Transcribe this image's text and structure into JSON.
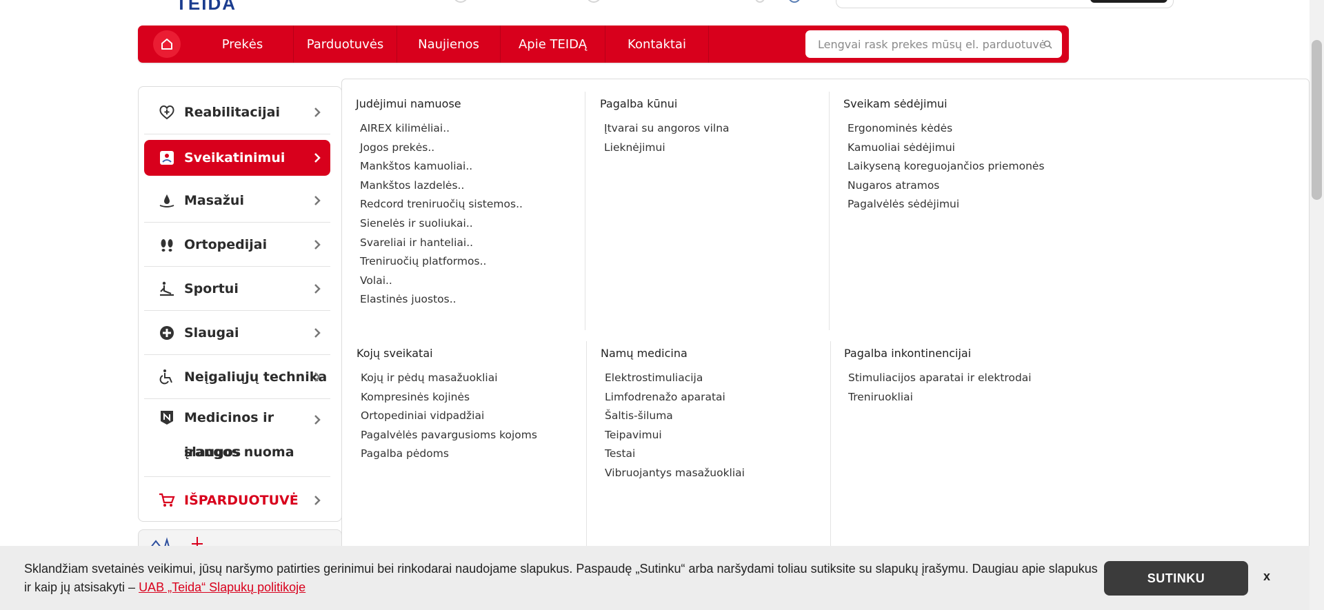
{
  "logo_text": "TEIDA",
  "nav": {
    "items": [
      {
        "label": "Prekės"
      },
      {
        "label": "Parduotuvės"
      },
      {
        "label": "Naujienos"
      },
      {
        "label": "Apie TEIDĄ"
      },
      {
        "label": "Kontaktai"
      }
    ],
    "search_placeholder": "Lengvai rask prekes mūsų el. parduotuvėje"
  },
  "sidebar": {
    "items": [
      {
        "label": "Reabilitacijai",
        "icon": "heart-plus-icon",
        "active": false
      },
      {
        "label": "Sveikatinimui",
        "icon": "wellness-icon",
        "active": true
      },
      {
        "label": "Masažui",
        "icon": "drop-icon",
        "active": false
      },
      {
        "label": "Ortopedijai",
        "icon": "footprints-icon",
        "active": false
      },
      {
        "label": "Sportui",
        "icon": "exercise-icon",
        "active": false
      },
      {
        "label": "Slaugai",
        "icon": "plus-circle-icon",
        "active": false
      },
      {
        "label": "Neįgaliųjų technika",
        "icon": "wheelchair-icon",
        "active": false
      },
      {
        "label": "Medicinos ir slaugos įrangos nuoma",
        "label_line1": "Medicinos ir slaugos",
        "label_line2": "įrangos nuoma",
        "icon": "n-badge-icon",
        "active": false
      },
      {
        "label": "IŠPARDUOTUVĖ",
        "icon": "cart-icon",
        "active": false
      }
    ]
  },
  "menu": {
    "columns": [
      {
        "title": "Judėjimui namuose",
        "links": [
          "AIREX kilimėliai..",
          "Jogos prekės..",
          "Mankštos kamuoliai..",
          "Mankštos lazdelės..",
          "Redcord treniruočių sistemos..",
          "Sienelės ir suoliukai..",
          "Svareliai ir hanteliai..",
          "Treniruočių platformos..",
          "Volai..",
          "Elastinės juostos.."
        ]
      },
      {
        "title": "Pagalba kūnui",
        "links": [
          "Įtvarai su angoros vilna",
          "Lieknėjimui"
        ]
      },
      {
        "title": "Sveikam sėdėjimui",
        "links": [
          "Ergonominės kėdės",
          "Kamuoliai sėdėjimui",
          "Laikyseną koreguojančios priemonės",
          "Nugaros atramos",
          "Pagalvėlės sėdėjimui"
        ]
      },
      {
        "title": "Kojų sveikatai",
        "links": [
          "Kojų ir pėdų masažuokliai",
          "Kompresinės kojinės",
          "Ortopediniai vidpadžiai",
          "Pagalvėlės pavargusioms kojoms",
          "Pagalba pėdoms"
        ]
      },
      {
        "title": "Namų medicina",
        "links": [
          "Elektrostimuliacija",
          "Limfodrenažo aparatai",
          "Šaltis-šiluma",
          "Teipavimui",
          "Testai",
          "Vibruojantys masažuokliai"
        ]
      },
      {
        "title": "Pagalba inkontinencijai",
        "links": [
          "Stimuliacijos aparatai ir elektrodai",
          "Treniruokliai"
        ]
      }
    ]
  },
  "cookie": {
    "text": "Sklandžiam svetainės veikimui, jūsų naršymo patirties gerinimui bei rinkodarai naudojame slapukus. Paspaudę „Sutinku“ arba naršydami toliau sutiksite su slapukų įrašymu. Daugiau apie slapukus ir kaip jų atsisakyti – ",
    "link": "UAB „Teida“ Slapukų politikoje ",
    "accept_label": "SUTINKU",
    "close_label": "x"
  },
  "colors": {
    "brand_red": "#d8001c",
    "dark_button": "#3b3b3b"
  }
}
